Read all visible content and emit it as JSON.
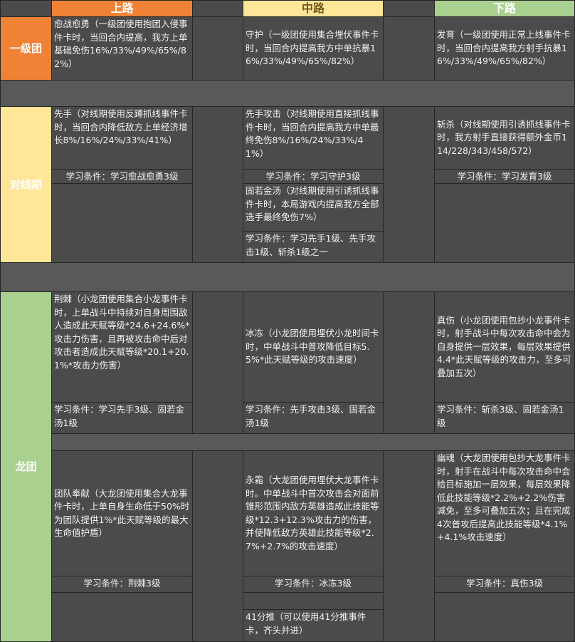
{
  "colors": {
    "top": "#f08236",
    "mid": "#ffe699",
    "bot": "#a9d08e",
    "cell": "#4b4b4b",
    "band": "#595959"
  },
  "header": {
    "top": "上路",
    "mid": "中路",
    "bot": "下路"
  },
  "categories": {
    "tier1": "一级团",
    "laning": "对线期",
    "dragon": "龙团"
  },
  "tier1": {
    "top": "愈战愈勇（一级团使用抱团入侵事件卡时，当回合内提高，我方上单基础免伤16%/33%/49%/65%/82%）",
    "mid": "守护（一级团使用集合埋伏事件卡时，当回合内提高我方中单抗暴16%/33%/49%/65%/82%）",
    "bot": "发育（一级团使用正常上线事件卡时，当回合内提高我方射手抗暴16%/33%/49%/65%/82%）"
  },
  "laning": {
    "top": "先手（对线期使用反蹲抓线事件卡时，当回合内降低敌方上单经济增长8%/16%/24%/33%/41%）",
    "top_req": "学习条件：学习愈战愈勇3级",
    "mid": "先手攻击（对线期使用直接抓线事件卡时，当回合内提高我方中单最终免伤8%/16%/24%/33%/41%）",
    "mid_req": "学习条件：学习守护3级",
    "mid2": "固若金汤（对线期使用引诱抓线事件卡时，本局游戏内提高我方全部选手最终免伤7%）",
    "mid2_req": "学习条件：学习先手1级、先手攻击1级、斩杀1级之一",
    "bot": "斩杀（对线期使用引诱抓线事件卡时，我方射手直接获得额外金币114/228/343/458/572）",
    "bot_req": "学习条件：学习发育3级"
  },
  "dragon1": {
    "top": "荆棘（小龙团使用集合小龙事件卡时，上单战斗中持续对自身周围敌人造成此天赋等级*24.6+24.6%*攻击力伤害，且再被攻击命中后对攻击者造成此天赋等级*20.1+20.1%*攻击力伤害）",
    "top_req": "学习条件：学习先手3级、固若金汤1级",
    "mid": "冰冻（小龙团使用埋伏小龙时间卡时，中单战斗中普攻降低目标5.5%*此天赋等级的攻击速度）",
    "mid_req": "学习条件：先手攻击3级、固若金汤1级",
    "bot": "真伤（小龙团使用包抄小龙事件卡时，射手战斗中每次攻击命中会为自身提供一层效果，每层效果提供4.4*此天赋等级的攻击力，至多可叠加五次）",
    "bot_req": "学习条件：斩杀3级、固若金汤1级"
  },
  "dragon2": {
    "top": "团队奉献（大龙团使用集合大龙事件卡时，上单自身生命低于50%时为团队提供1%*此天赋等级的最大生命值护盾）",
    "top_req": "学习条件：荆棘3级",
    "mid": "永霜（大龙团使用埋伏大龙事件卡时。中单战斗中首次攻击会对面前锥形范围内敌方英雄造成此技能等级*12.3+12.3%攻击力的伤害，并使降低敌方英雄此技能等级*2.7%+2.7%的攻击速度）",
    "mid_req": "学习条件：冰冻3级",
    "mid3": "41分推（可以使用41分推事件卡，齐头并进）",
    "bot": "幽魂（大龙团使用包抄大龙事件卡时，射手在战斗中每次攻击命中会给目标施加一层效果，每层效果降低此技能等级*2.2%+2.2%伤害减免，至多可叠加五次；且在完成4次普攻后提高此技能等级*4.1%+4.1%攻击速度）",
    "bot_req": "学习条件：真伤3级"
  }
}
